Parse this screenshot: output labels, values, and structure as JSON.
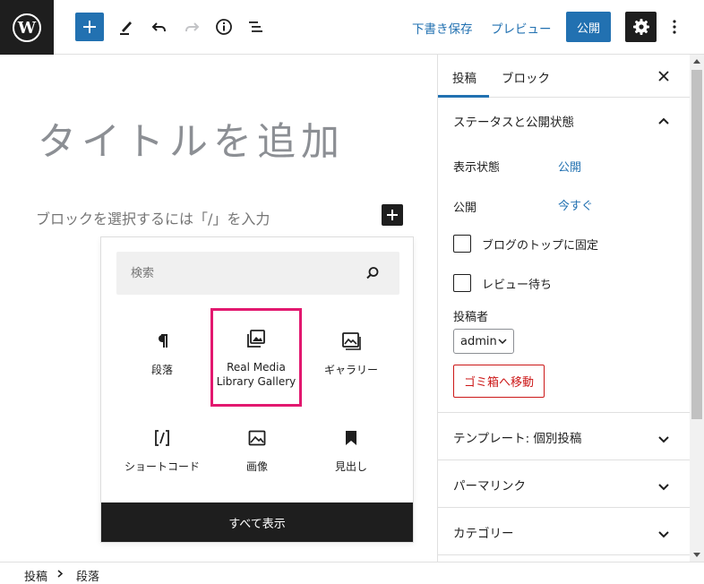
{
  "toolbar": {
    "save_draft": "下書き保存",
    "preview": "プレビュー",
    "publish": "公開"
  },
  "editor": {
    "title_placeholder": "タイトルを追加",
    "block_placeholder": "ブロックを選択するには「/」を入力"
  },
  "inserter": {
    "search_placeholder": "検索",
    "blocks": [
      {
        "label": "段落",
        "icon": "paragraph-icon"
      },
      {
        "label": "Real Media\nLibrary Gallery",
        "icon": "gallery-stack-icon",
        "highlighted": true
      },
      {
        "label": "ギャラリー",
        "icon": "gallery-icon"
      },
      {
        "label": "ショートコード",
        "icon": "shortcode-icon"
      },
      {
        "label": "画像",
        "icon": "image-icon"
      },
      {
        "label": "見出し",
        "icon": "bookmark-icon"
      }
    ],
    "show_all": "すべて表示"
  },
  "sidebar": {
    "tabs": [
      "投稿",
      "ブロック"
    ],
    "active_tab": "投稿",
    "status_panel": {
      "title": "ステータスと公開状態",
      "visibility_label": "表示状態",
      "visibility_value": "公開",
      "publish_label": "公開",
      "publish_value": "今すぐ",
      "sticky_label": "ブログのトップに固定",
      "pending_label": "レビュー待ち",
      "author_label": "投稿者",
      "author_value": "admin",
      "trash": "ゴミ箱へ移動"
    },
    "panels": [
      "テンプレート: 個別投稿",
      "パーマリンク",
      "カテゴリー"
    ]
  },
  "breadcrumb": [
    "投稿",
    "段落"
  ],
  "colors": {
    "accent": "#2271b1",
    "dark": "#1e1e1e",
    "highlight": "#e2186f",
    "danger": "#cc1818"
  }
}
